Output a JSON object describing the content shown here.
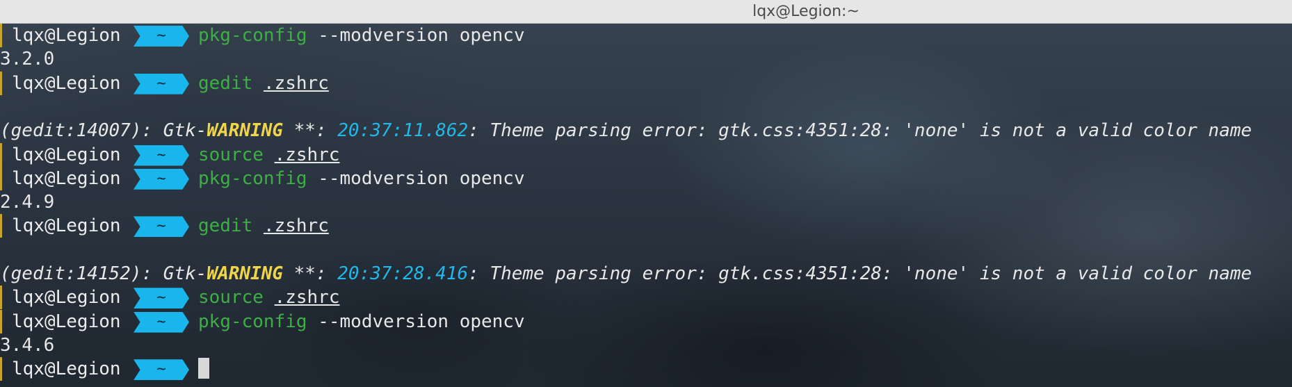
{
  "window": {
    "title": "lqx@Legion:~"
  },
  "prompt": {
    "user": "lqx@Legion",
    "dir": "~"
  },
  "lines": [
    {
      "kind": "prompt",
      "cmd": "pkg-config",
      "arg": "--modversion opencv",
      "arg_style": "plain"
    },
    {
      "kind": "output",
      "text": "3.2.0"
    },
    {
      "kind": "prompt",
      "cmd": "gedit",
      "arg": ".zshrc",
      "arg_style": "underline"
    },
    {
      "kind": "blank"
    },
    {
      "kind": "warning",
      "prefix": "(gedit:14007): Gtk-",
      "level": "WARNING",
      "sep": " **: ",
      "time": "20:37:11.862",
      "msg": ": Theme parsing error: gtk.css:4351:28: 'none' is not a valid color name"
    },
    {
      "kind": "prompt",
      "cmd": "source",
      "arg": ".zshrc",
      "arg_style": "underline"
    },
    {
      "kind": "prompt",
      "cmd": "pkg-config",
      "arg": "--modversion opencv",
      "arg_style": "plain"
    },
    {
      "kind": "output",
      "text": "2.4.9"
    },
    {
      "kind": "prompt",
      "cmd": "gedit",
      "arg": ".zshrc",
      "arg_style": "underline"
    },
    {
      "kind": "blank"
    },
    {
      "kind": "warning",
      "prefix": "(gedit:14152): Gtk-",
      "level": "WARNING",
      "sep": " **: ",
      "time": "20:37:28.416",
      "msg": ": Theme parsing error: gtk.css:4351:28: 'none' is not a valid color name"
    },
    {
      "kind": "prompt",
      "cmd": "source",
      "arg": ".zshrc",
      "arg_style": "underline"
    },
    {
      "kind": "prompt",
      "cmd": "pkg-config",
      "arg": "--modversion opencv",
      "arg_style": "plain"
    },
    {
      "kind": "output",
      "text": "3.4.6"
    },
    {
      "kind": "prompt_cursor"
    }
  ],
  "colors": {
    "prompt_dir_bg": "#18b6ec",
    "command": "#3cb043",
    "warning": "#f0d54a",
    "timestamp": "#22b8e8",
    "prompt_marker": "#c8a428"
  }
}
